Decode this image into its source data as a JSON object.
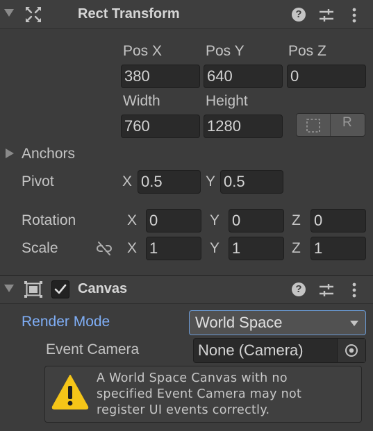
{
  "rect_transform": {
    "title": "Rect Transform",
    "labels": {
      "pos_x": "Pos X",
      "pos_y": "Pos Y",
      "pos_z": "Pos Z",
      "width": "Width",
      "height": "Height"
    },
    "values": {
      "pos_x": "380",
      "pos_y": "640",
      "pos_z": "0",
      "width": "760",
      "height": "1280"
    },
    "anchors_label": "Anchors",
    "pivot": {
      "label": "Pivot",
      "x_axis": "X",
      "y_axis": "Y",
      "x": "0.5",
      "y": "0.5"
    },
    "rotation": {
      "label": "Rotation",
      "x_axis": "X",
      "y_axis": "Y",
      "z_axis": "Z",
      "x": "0",
      "y": "0",
      "z": "0"
    },
    "scale": {
      "label": "Scale",
      "x_axis": "X",
      "y_axis": "Y",
      "z_axis": "Z",
      "x": "1",
      "y": "1",
      "z": "1"
    },
    "blueprint_button_glyph": "R"
  },
  "canvas": {
    "title": "Canvas",
    "enabled": true,
    "render_mode": {
      "label": "Render Mode",
      "value": "World Space"
    },
    "event_camera": {
      "label": "Event Camera",
      "value": "None (Camera)"
    },
    "warning": {
      "line1": "A World Space Canvas with no",
      "line2": "specified Event Camera may not",
      "line3": "register UI events correctly."
    }
  },
  "header_icons": {
    "help": "?"
  },
  "colors": {
    "accent_blue": "#7faef6",
    "warning_yellow": "#f5c518",
    "panel_bg": "#3c3c3c"
  }
}
